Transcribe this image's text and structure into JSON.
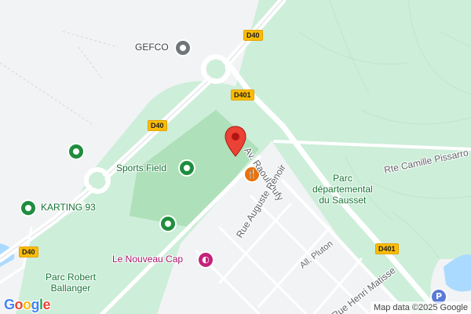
{
  "labels": {
    "gefco": "GEFCO",
    "sports_field": "Sports Field",
    "karting": "KARTING 93",
    "nouveau_cap": "Le Nouveau Cap",
    "parc_sausset_line1": "Parc",
    "parc_sausset_line2": "départemental",
    "parc_sausset_line3": "du Sausset",
    "parc_ballanger_line1": "Parc Robert",
    "parc_ballanger_line2": "Ballanger"
  },
  "streets": {
    "raoul_dufy": "Av. Raoul Dufy",
    "auguste_renoir": "Rue Auguste Renoir",
    "camille_pissarro": "Rte Camille Pissarro",
    "pluton": "All. Pluton",
    "henri_matisse": "Rue Henri Matisse"
  },
  "road_shields": {
    "d40_top": "D40",
    "d401_mid": "D401",
    "d40_left": "D40",
    "d40_bottom": "D40",
    "d401_right": "D401"
  },
  "icons": {
    "gefco": "gray-circle-poi-icon",
    "sports_field": "green-park-poi-icon",
    "karting": "green-park-poi-icon",
    "restaurant": "fork-knife-icon",
    "nouveau_cap": "theater-masks-icon",
    "parking": "parking-p-icon",
    "pin": "red-location-marker-icon"
  },
  "colors": {
    "park": "#cdeed9",
    "park_light": "#e4f5e6",
    "water": "#aadaff",
    "road": "#ffffff",
    "poi_green": "#1e8e3e",
    "marker_red": "#ea4335",
    "shield_yellow": "#fbbc04"
  },
  "footer": {
    "logo": "Google",
    "attribution": "Map data ©2025 Google"
  }
}
